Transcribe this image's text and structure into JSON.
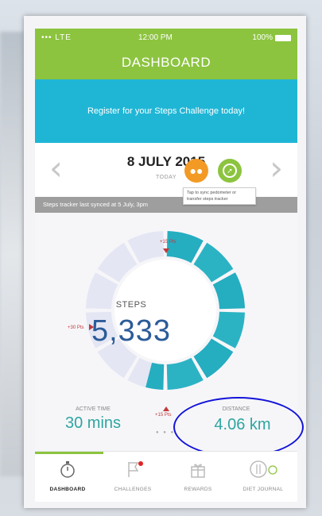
{
  "status_bar": {
    "carrier": "••• LTE",
    "time": "12:00 PM",
    "battery": "100%"
  },
  "header": {
    "title": "DASHBOARD"
  },
  "banner": {
    "text": "Register for your Steps Challenge today!"
  },
  "date_nav": {
    "date": "8 JULY 2015",
    "sub": "TODAY",
    "prev_icon": "chevron-left-icon",
    "next_icon": "chevron-right-icon"
  },
  "sync": {
    "text": "Steps tracker last synced at 5 July, 3pm",
    "tooltip": "Tap to sync pedometer or transfer steps tracker"
  },
  "steps": {
    "label": "STEPS",
    "value": "5,333",
    "progress_fraction": 0.54
  },
  "point_markers": {
    "top": "+15 Pts",
    "left": "+30 Pts",
    "bottom": "+15 Pts"
  },
  "active_time": {
    "label": "ACTIVE TIME",
    "value": "30 mins"
  },
  "distance": {
    "label": "DISTANCE",
    "value": "4.06 km"
  },
  "tabs": [
    {
      "label": "DASHBOARD",
      "icon": "stopwatch-icon"
    },
    {
      "label": "CHALLENGES",
      "icon": "flag-icon"
    },
    {
      "label": "REWARDS",
      "icon": "gift-icon"
    },
    {
      "label": "DIET JOURNAL",
      "icon": "cutlery-icon"
    }
  ],
  "colors": {
    "green": "#8cc43f",
    "blue": "#1fb6d6",
    "teal": "#2bb3c4",
    "orange": "#f39a25",
    "value_text": "#2fa5a0"
  }
}
